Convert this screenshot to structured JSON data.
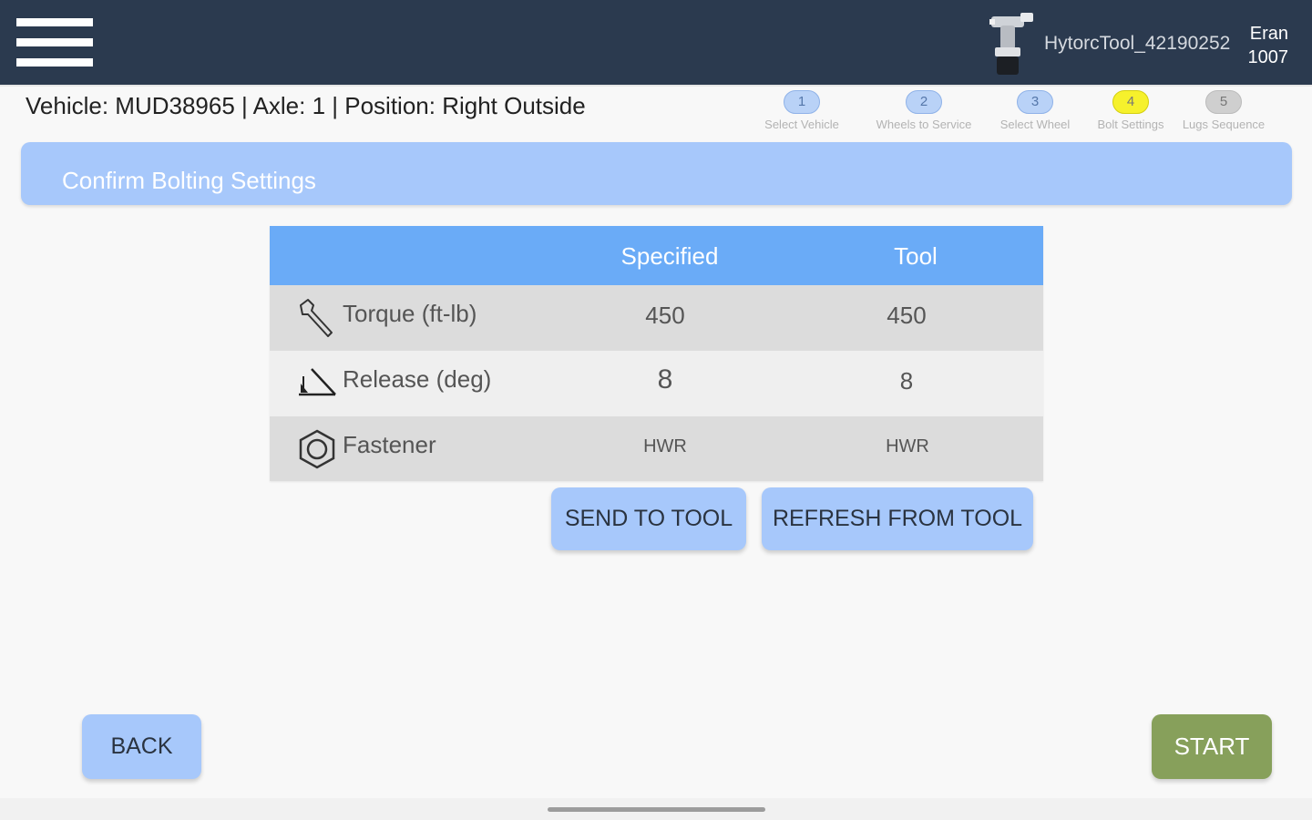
{
  "topbar": {
    "tool_name": "HytorcTool_42190252",
    "user_name": "Eran",
    "user_id": "1007",
    "background_color": "#2b3a4f"
  },
  "icons": {
    "menu": "hamburger-menu-icon",
    "tool": "power-tool-icon",
    "torque": "wrench-icon",
    "release": "angle-icon",
    "fastener": "hex-nut-icon"
  },
  "vehicle_info": "Vehicle: MUD38965 |  Axle: 1 | Position: Right Outside",
  "steps": [
    {
      "number": "1",
      "label": "Select Vehicle",
      "state": "done"
    },
    {
      "number": "2",
      "label": "Wheels to Service",
      "state": "done"
    },
    {
      "number": "3",
      "label": "Select Wheel",
      "state": "done"
    },
    {
      "number": "4",
      "label": "Bolt Settings",
      "state": "active"
    },
    {
      "number": "5",
      "label": "Lugs Sequence",
      "state": "pending"
    }
  ],
  "section_title": "Confirm Bolting Settings",
  "table": {
    "headers": {
      "specified": "Specified",
      "tool": "Tool"
    },
    "rows": [
      {
        "label": "Torque (ft-lb)",
        "specified": "450",
        "tool": "450"
      },
      {
        "label": "Release (deg)",
        "specified": "8",
        "tool": "8"
      },
      {
        "label": "Fastener",
        "specified": "HWR",
        "tool": "HWR"
      }
    ]
  },
  "buttons": {
    "send": "SEND TO TOOL",
    "refresh": "REFRESH FROM TOOL",
    "back": "BACK",
    "start": "START"
  },
  "colors": {
    "accent_blue": "#a7c8fb",
    "header_blue": "#6aabf7",
    "start_green": "#87a05b",
    "active_step": "#f6f12c"
  }
}
